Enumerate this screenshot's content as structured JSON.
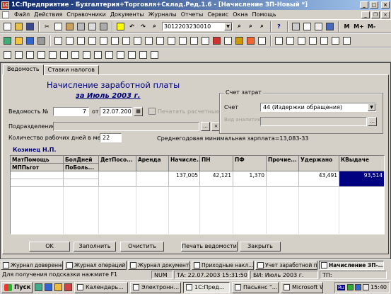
{
  "window": {
    "title": "1С:Предприятие - Бухгалтерия+Торговля+Склад.Ред.1.6 - [Начисление ЗП-Новый *]",
    "app_icon": "1С",
    "min": "_",
    "max": "□",
    "close": "×"
  },
  "menu": {
    "items": [
      "Файл",
      "Действия",
      "Справочники",
      "Документы",
      "Журналы",
      "Отчеты",
      "Сервис",
      "Окна",
      "Помощь"
    ]
  },
  "toolbar1": {
    "search_value": "3012203230010",
    "m_label": "M",
    "mplus_label": "M+",
    "mminus_label": "M-"
  },
  "tabs": [
    {
      "label": "Ведомость",
      "active": true
    },
    {
      "label": "Ставки налогов",
      "active": false
    }
  ],
  "form": {
    "title": "Начисление заработной платы",
    "period": "за Июль 2003 г.",
    "vedomost_label": "Ведомость №",
    "vedomost_number": "7",
    "date_from_label": "от",
    "date_value": "22.07.2003",
    "print_checkbox_label": "Печатать расчетные",
    "department_label": "Подразделение",
    "department_value": "",
    "workdays_label": "Количество рабочих дней в месяце",
    "workdays_value": "22",
    "min_salary_text": "Среднегодовая минимальная зарплата=13,083-33",
    "cost_group_label": "Счет затрат",
    "account_label": "Счет",
    "account_value": "44 (Издержки обращения)",
    "analytics_label": "Вид аналитики",
    "analytics_value": "",
    "employee_name": "Козинец Н.П."
  },
  "grid": {
    "headers_row1": [
      "МатПомощь",
      "БолДней",
      "ДетПосо...",
      "Аренда",
      "Начисле...",
      "ПН",
      "ПФ",
      "Прочие...",
      "Удержано",
      "КВыдаче"
    ],
    "headers_row2": [
      "МППьгот",
      "ПоБоль...",
      "",
      "",
      "",
      "",
      "",
      "",
      "",
      ""
    ],
    "row1": [
      "",
      "",
      "",
      "",
      "137,005",
      "42,121",
      "1,370",
      "",
      "43,491",
      "93,514"
    ]
  },
  "buttons": {
    "ok": "OK",
    "fill": "Заполнить",
    "clear": "Очистить",
    "print": "Печать ведомости",
    "close": "Закрыть"
  },
  "window_strip": [
    {
      "label": "Журнал доверенно...",
      "active": false
    },
    {
      "label": "Журнал операций ...",
      "active": false
    },
    {
      "label": "Журнал документо...",
      "active": false
    },
    {
      "label": "Приходные накл...",
      "active": false
    },
    {
      "label": "Учет заработной п...",
      "active": false
    },
    {
      "label": "Начисление ЗП-...",
      "active": true
    }
  ],
  "status": {
    "hint": "Для получения подсказки нажмите F1",
    "num": "NUM",
    "ta": "ТА: 22.07.2003 15:31:50",
    "bi": "БИ: Июль 2003 г.",
    "tp": "ТП:"
  },
  "taskbar": {
    "start": "Пуск",
    "tasks": [
      {
        "label": "Календарь...",
        "active": false
      },
      {
        "label": "Электронн...",
        "active": false
      },
      {
        "label": "1С:Пред...",
        "active": true
      },
      {
        "label": "Пасьянс \"...",
        "active": false
      },
      {
        "label": "Microsoft W...",
        "active": false
      }
    ],
    "lang": "Ru",
    "clock": "15:40"
  },
  "colors": {
    "title_gradient_start": "#0a246a",
    "title_gradient_end": "#a6caf0",
    "heading_blue": "#000080",
    "selected_cell": "#000080"
  }
}
